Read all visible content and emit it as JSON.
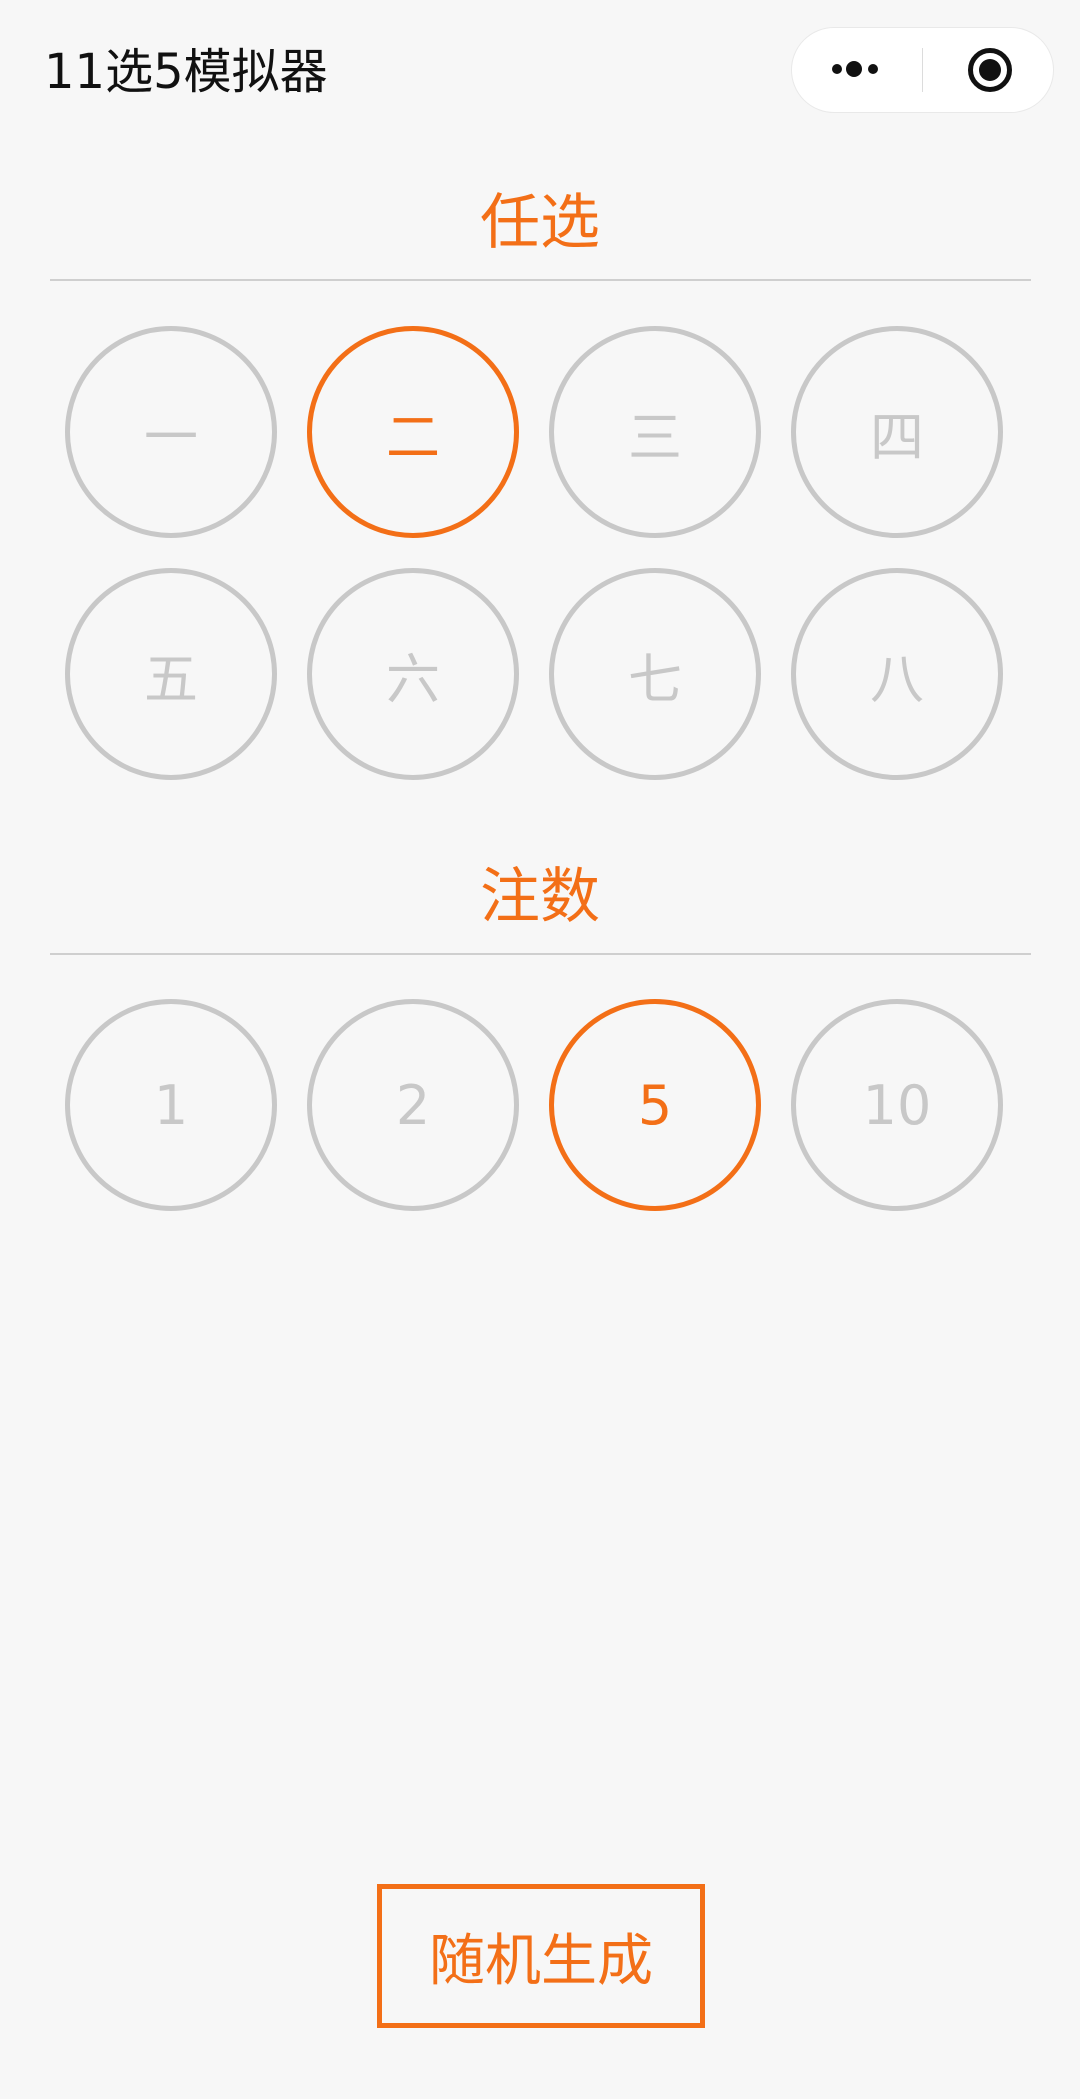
{
  "nav": {
    "title": "11选5模拟器",
    "more_icon": "more-dots-icon",
    "close_icon": "target-circle-icon"
  },
  "pick_section": {
    "title": "任选",
    "options": [
      "一",
      "二",
      "三",
      "四",
      "五",
      "六",
      "七",
      "八"
    ],
    "selected": "二"
  },
  "bets_section": {
    "title": "注数",
    "options": [
      "1",
      "2",
      "5",
      "10"
    ],
    "selected": "5"
  },
  "generate_button": {
    "label": "随机生成"
  },
  "colors": {
    "accent": "#f36f17",
    "unselected": "#c8c8c8",
    "background": "#f7f7f7"
  }
}
